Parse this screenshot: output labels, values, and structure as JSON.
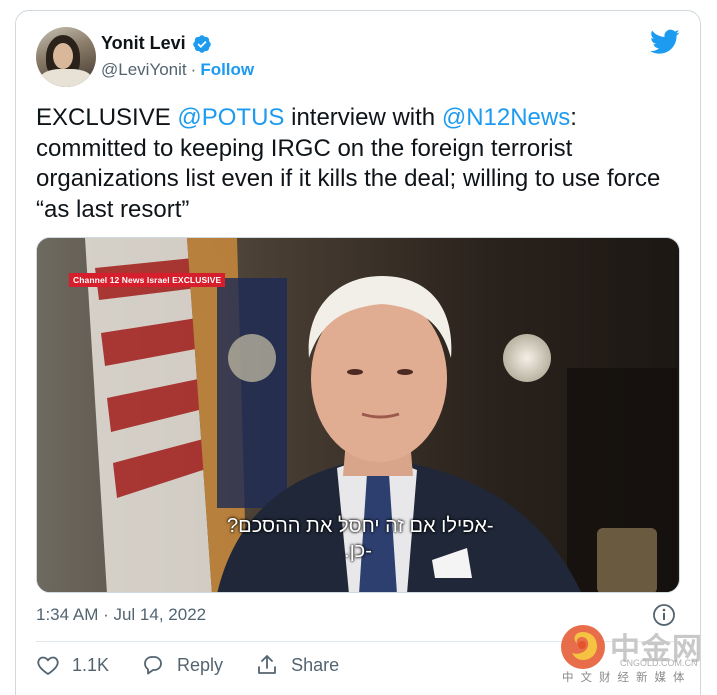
{
  "author": {
    "display_name": "Yonit Levi",
    "handle": "@LeviYonit",
    "separator": "·",
    "follow_label": "Follow",
    "verified": true
  },
  "tweet": {
    "text_prefix": "EXCLUSIVE ",
    "mention_1": "@POTUS",
    "text_mid": " interview with ",
    "mention_2": "@N12News",
    "text_suffix": ": committed to keeping IRGC on the foreign terrorist organizations list even if it kills the deal; willing to use force “as last resort”",
    "timestamp": "1:34 AM · Jul 14, 2022"
  },
  "media": {
    "badge": "Channel 12 News Israel EXCLUSIVE",
    "subtitle_line_1": "-אפילו אם זה יחסל את ההסכם?",
    "subtitle_line_2": "-כן."
  },
  "actions": {
    "like_count": "1.1K",
    "reply_label": "Reply",
    "share_label": "Share"
  },
  "watermark": {
    "brand": "中金网",
    "url": "CNGOLD.COM.CN",
    "tagline": "中文财经新媒体"
  },
  "colors": {
    "accent": "#1d9bf0",
    "text": "#0f1419",
    "secondary": "#536471",
    "border": "#cfd9de"
  }
}
